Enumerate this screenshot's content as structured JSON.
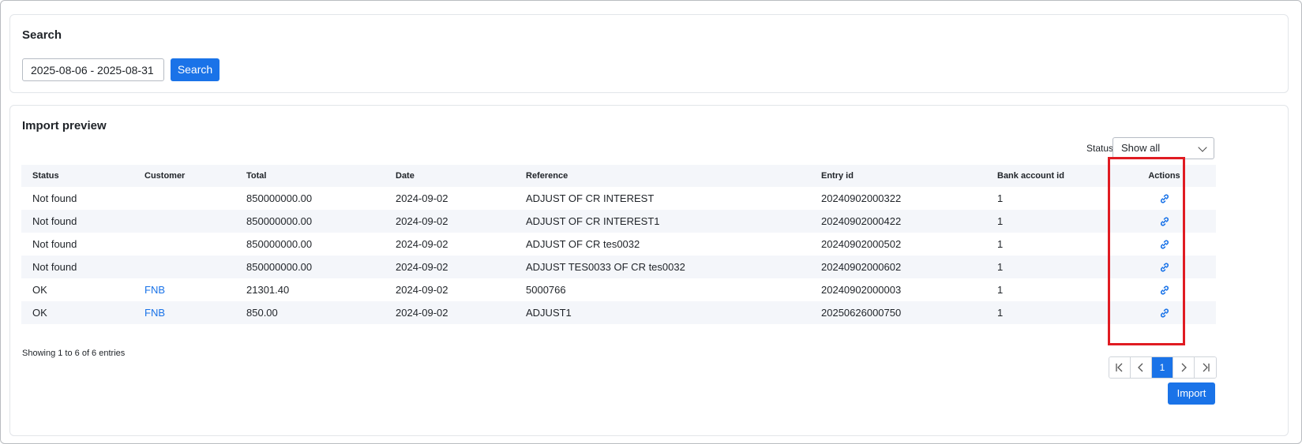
{
  "search": {
    "title": "Search",
    "date_range": "2025-08-06 - 2025-08-31",
    "button_label": "Search"
  },
  "preview": {
    "title": "Import preview",
    "status_filter_label": "Status",
    "status_filter_value": "Show all",
    "columns": [
      "Status",
      "Customer",
      "Total",
      "Date",
      "Reference",
      "Entry id",
      "Bank account id",
      "Actions"
    ],
    "rows": [
      {
        "status": "Not found",
        "customer": "",
        "total": "850000000.00",
        "date": "2024-09-02",
        "reference": "ADJUST OF CR INTEREST",
        "entry_id": "20240902000322",
        "bank_account_id": "1"
      },
      {
        "status": "Not found",
        "customer": "",
        "total": "850000000.00",
        "date": "2024-09-02",
        "reference": "ADJUST OF CR INTEREST1",
        "entry_id": "20240902000422",
        "bank_account_id": "1"
      },
      {
        "status": "Not found",
        "customer": "",
        "total": "850000000.00",
        "date": "2024-09-02",
        "reference": "ADJUST OF CR tes0032",
        "entry_id": "20240902000502",
        "bank_account_id": "1"
      },
      {
        "status": "Not found",
        "customer": "",
        "total": "850000000.00",
        "date": "2024-09-02",
        "reference": "ADJUST TES0033 OF CR tes0032",
        "entry_id": "20240902000602",
        "bank_account_id": "1"
      },
      {
        "status": "OK",
        "customer": "FNB",
        "total": "21301.40",
        "date": "2024-09-02",
        "reference": "5000766",
        "entry_id": "20240902000003",
        "bank_account_id": "1"
      },
      {
        "status": "OK",
        "customer": "FNB",
        "total": "850.00",
        "date": "2024-09-02",
        "reference": "ADJUST1",
        "entry_id": "20250626000750",
        "bank_account_id": "1"
      }
    ],
    "entries_info": "Showing 1 to 6 of 6 entries",
    "pagination": {
      "current_page": "1"
    },
    "import_label": "Import"
  },
  "icons": {
    "row_action": "link-icon",
    "first": "first-page-icon",
    "prev": "chevron-left-icon",
    "next": "chevron-right-icon",
    "last": "last-page-icon",
    "dropdown": "chevron-down-icon"
  },
  "colors": {
    "accent": "#1a73e8",
    "highlight": "#e01b22",
    "row_stripe": "#f4f6fa"
  }
}
